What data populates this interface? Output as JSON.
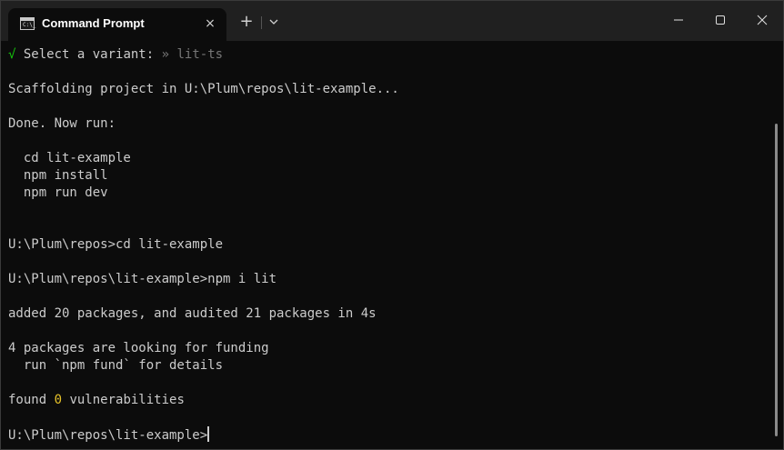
{
  "window": {
    "tab_title": "Command Prompt",
    "tab_icon_text": "C:\\_",
    "close_tab_symbol": "×",
    "new_tab_symbol": "+"
  },
  "terminal": {
    "select_check": "√",
    "select_label": "Select a variant:",
    "select_arrow": "»",
    "select_value": "lit-ts",
    "scaffolding": "Scaffolding project in U:\\Plum\\repos\\lit-example...",
    "done": "Done. Now run:",
    "cmd_cd": "  cd lit-example",
    "cmd_install": "  npm install",
    "cmd_dev": "  npm run dev",
    "prompt_cd": "U:\\Plum\\repos>cd lit-example",
    "prompt_npm": "U:\\Plum\\repos\\lit-example>npm i lit",
    "added": "added 20 packages, and audited 21 packages in 4s",
    "funding_1": "4 packages are looking for funding",
    "funding_2": "  run `npm fund` for details",
    "found_pre": "found ",
    "found_count": "0",
    "found_post": " vulnerabilities",
    "final_prompt": "U:\\Plum\\repos\\lit-example>"
  },
  "colors": {
    "background": "#0c0c0c",
    "titlebar": "#202020",
    "text": "#cccccc",
    "check_green": "#16c60c",
    "dim_gray": "#767676",
    "count_yellow": "#e6c229"
  }
}
